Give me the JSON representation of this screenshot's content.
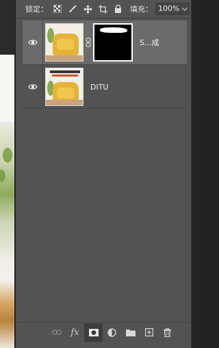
{
  "lock_row": {
    "lock_label": "锁定：",
    "fill_label": "填充：",
    "fill_value": "100%"
  },
  "layers": [
    {
      "name": "S...成",
      "selected": true,
      "has_mask": true,
      "visible": true
    },
    {
      "name": "DITU",
      "selected": false,
      "has_mask": false,
      "visible": true
    }
  ],
  "icons": {
    "lock_transparent": "checkerboard-icon",
    "lock_image": "brush-icon",
    "lock_position": "move-icon",
    "lock_artboard": "artboard-icon",
    "lock_all": "lock-icon",
    "fill_dropdown": "chevron-down-icon",
    "visibility": "eye-icon",
    "link": "chain-link-icon",
    "toolbar": [
      "link-layers-icon",
      "fx-icon",
      "add-mask-icon",
      "adjustment-layer-icon",
      "folder-icon",
      "new-layer-icon",
      "trash-icon"
    ]
  },
  "toolbar": {
    "fx_label": "fx"
  },
  "colors": {
    "panel_bg": "#535353",
    "selected_row": "#6b6b6b",
    "app_bg": "#232323"
  }
}
